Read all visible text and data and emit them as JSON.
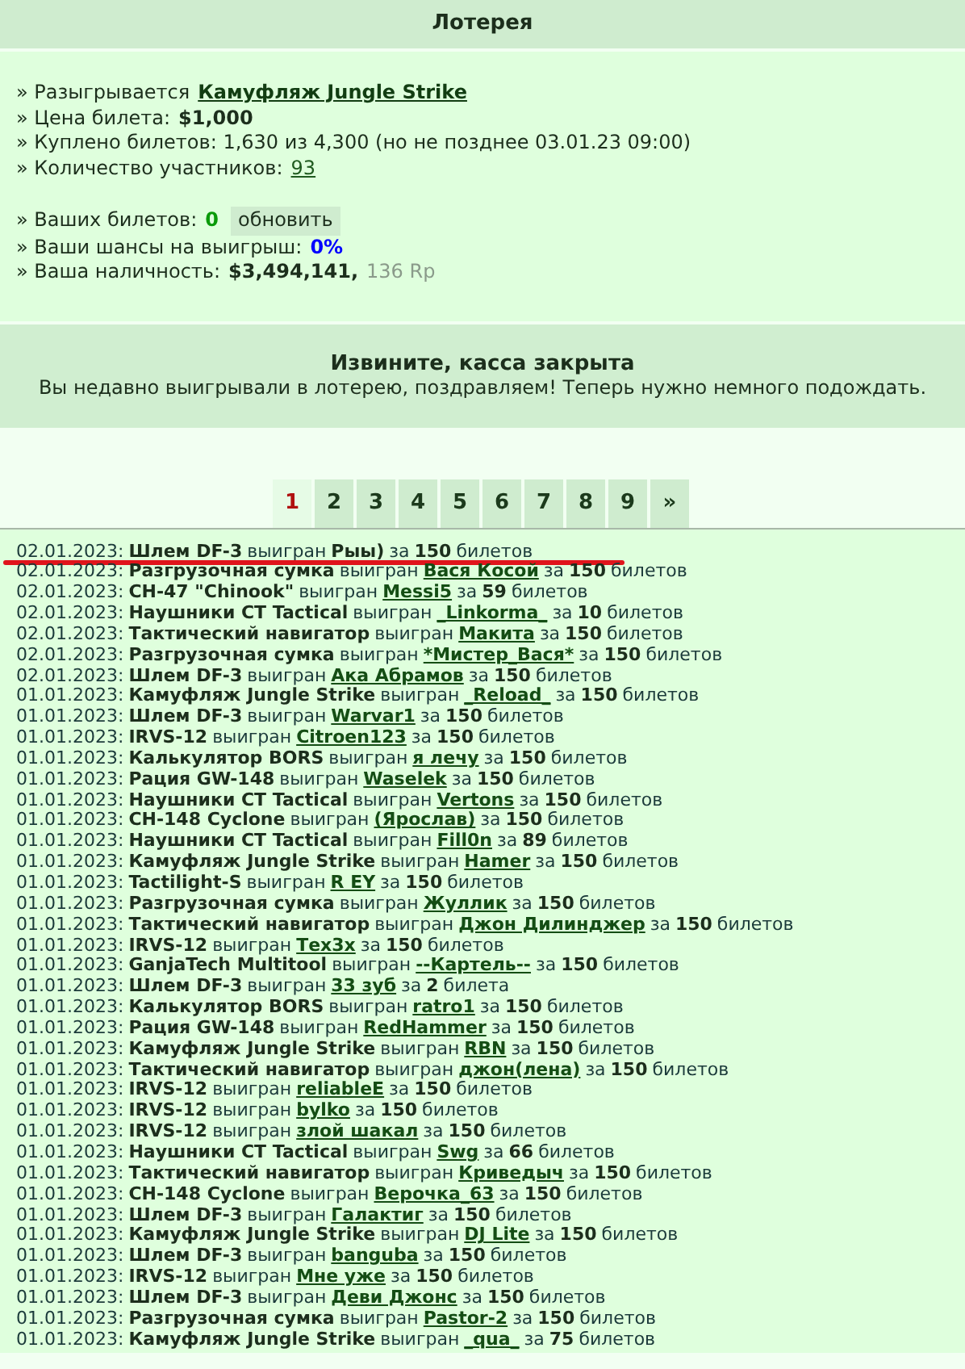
{
  "title": "Лотерея",
  "info_groups": [
    [
      {
        "label": "» Разыгрывается",
        "value": "Камуфляж Jungle Strike",
        "kind": "link"
      },
      {
        "label": "» Цена билета:",
        "value": "$1,000",
        "kind": "bold"
      },
      {
        "label": "» Куплено билетов: 1,630 из 4,300 (но не позднее 03.01.23 09:00)"
      },
      {
        "label": "» Количество участников:",
        "value": "93",
        "kind": "plainlink"
      }
    ],
    [
      {
        "label": "» Ваших билетов:",
        "value": "0",
        "kind": "green",
        "button": "обновить"
      },
      {
        "label": "» Ваши шансы на выигрыш:",
        "value": "0%",
        "kind": "blue"
      },
      {
        "label": "» Ваша наличность:",
        "value": "$3,494,141,",
        "kind": "bold",
        "extra": "136 Rp"
      }
    ]
  ],
  "closed": {
    "title": "Извините, касса закрыта",
    "text": "Вы недавно выигрывали в лотерею, поздравляем! Теперь нужно немного подождать."
  },
  "pages": [
    {
      "label": "1",
      "selected": true
    },
    {
      "label": "2",
      "selected": false
    },
    {
      "label": "3",
      "selected": false
    },
    {
      "label": "4",
      "selected": false
    },
    {
      "label": "5",
      "selected": false
    },
    {
      "label": "6",
      "selected": false
    },
    {
      "label": "7",
      "selected": false
    },
    {
      "label": "8",
      "selected": false
    },
    {
      "label": "9",
      "selected": false
    },
    {
      "label": "»",
      "selected": false
    }
  ],
  "rows": [
    {
      "date": "02.01.2023:",
      "prize": "Шлем DF-3",
      "won": "выигран",
      "winner": "Рыы)",
      "linked": false,
      "za": "за",
      "count": "150",
      "unit": "билетов",
      "marked": true
    },
    {
      "date": "02.01.2023:",
      "prize": "Разгрузочная сумка",
      "won": "выигран",
      "winner": "Вася Косой",
      "linked": true,
      "za": "за",
      "count": "150",
      "unit": "билетов",
      "marked": false
    },
    {
      "date": "02.01.2023:",
      "prize": "CH-47 \"Chinook\"",
      "won": "выигран",
      "winner": "Messi5",
      "linked": true,
      "za": "за",
      "count": "59",
      "unit": "билетов",
      "marked": false
    },
    {
      "date": "02.01.2023:",
      "prize": "Наушники CT Tactical",
      "won": "выигран",
      "winner": "_Linkorma_",
      "linked": true,
      "za": "за",
      "count": "10",
      "unit": "билетов",
      "marked": false
    },
    {
      "date": "02.01.2023:",
      "prize": "Тактический навигатор",
      "won": "выигран",
      "winner": "Макита",
      "linked": true,
      "za": "за",
      "count": "150",
      "unit": "билетов",
      "marked": false
    },
    {
      "date": "02.01.2023:",
      "prize": "Разгрузочная сумка",
      "won": "выигран",
      "winner": "*Мистер_Вася*",
      "linked": true,
      "za": "за",
      "count": "150",
      "unit": "билетов",
      "marked": false
    },
    {
      "date": "02.01.2023:",
      "prize": "Шлем DF-3",
      "won": "выигран",
      "winner": "Ака Абрамов",
      "linked": true,
      "za": "за",
      "count": "150",
      "unit": "билетов",
      "marked": false
    },
    {
      "date": "01.01.2023:",
      "prize": "Камуфляж Jungle Strike",
      "won": "выигран",
      "winner": "_Reload_",
      "linked": true,
      "za": "за",
      "count": "150",
      "unit": "билетов",
      "marked": false
    },
    {
      "date": "01.01.2023:",
      "prize": "Шлем DF-3",
      "won": "выигран",
      "winner": "Warvar1",
      "linked": true,
      "za": "за",
      "count": "150",
      "unit": "билетов",
      "marked": false
    },
    {
      "date": "01.01.2023:",
      "prize": "IRVS-12",
      "won": "выигран",
      "winner": "Citroen123",
      "linked": true,
      "za": "за",
      "count": "150",
      "unit": "билетов",
      "marked": false
    },
    {
      "date": "01.01.2023:",
      "prize": "Калькулятор BORS",
      "won": "выигран",
      "winner": "я лечу",
      "linked": true,
      "za": "за",
      "count": "150",
      "unit": "билетов",
      "marked": false
    },
    {
      "date": "01.01.2023:",
      "prize": "Рация GW-148",
      "won": "выигран",
      "winner": "Waselek",
      "linked": true,
      "za": "за",
      "count": "150",
      "unit": "билетов",
      "marked": false
    },
    {
      "date": "01.01.2023:",
      "prize": "Наушники CT Tactical",
      "won": "выигран",
      "winner": "Vertons",
      "linked": true,
      "za": "за",
      "count": "150",
      "unit": "билетов",
      "marked": false
    },
    {
      "date": "01.01.2023:",
      "prize": "CH-148 Cyclone",
      "won": "выигран",
      "winner": "(Ярослав)",
      "linked": true,
      "za": "за",
      "count": "150",
      "unit": "билетов",
      "marked": false
    },
    {
      "date": "01.01.2023:",
      "prize": "Наушники CT Tactical",
      "won": "выигран",
      "winner": "Fill0n",
      "linked": true,
      "za": "за",
      "count": "89",
      "unit": "билетов",
      "marked": false
    },
    {
      "date": "01.01.2023:",
      "prize": "Камуфляж Jungle Strike",
      "won": "выигран",
      "winner": "Hamer",
      "linked": true,
      "za": "за",
      "count": "150",
      "unit": "билетов",
      "marked": false
    },
    {
      "date": "01.01.2023:",
      "prize": "Tactilight-S",
      "won": "выигран",
      "winner": "R EY",
      "linked": true,
      "za": "за",
      "count": "150",
      "unit": "билетов",
      "marked": false
    },
    {
      "date": "01.01.2023:",
      "prize": "Разгрузочная сумка",
      "won": "выигран",
      "winner": "Жуллик",
      "linked": true,
      "za": "за",
      "count": "150",
      "unit": "билетов",
      "marked": false
    },
    {
      "date": "01.01.2023:",
      "prize": "Тактический навигатор",
      "won": "выигран",
      "winner": "Джон Дилинджер",
      "linked": true,
      "za": "за",
      "count": "150",
      "unit": "билетов",
      "marked": false
    },
    {
      "date": "01.01.2023:",
      "prize": "IRVS-12",
      "won": "выигран",
      "winner": "Тех3х",
      "linked": true,
      "za": "за",
      "count": "150",
      "unit": "билетов",
      "marked": false
    },
    {
      "date": "01.01.2023:",
      "prize": "GanjaTech Multitool",
      "won": "выигран",
      "winner": "--Картель--",
      "linked": true,
      "za": "за",
      "count": "150",
      "unit": "билетов",
      "marked": false
    },
    {
      "date": "01.01.2023:",
      "prize": "Шлем DF-3",
      "won": "выигран",
      "winner": "33 зуб",
      "linked": true,
      "za": "за",
      "count": "2",
      "unit": "билета",
      "marked": false
    },
    {
      "date": "01.01.2023:",
      "prize": "Калькулятор BORS",
      "won": "выигран",
      "winner": "ratro1",
      "linked": true,
      "za": "за",
      "count": "150",
      "unit": "билетов",
      "marked": false
    },
    {
      "date": "01.01.2023:",
      "prize": "Рация GW-148",
      "won": "выигран",
      "winner": "RedHammer",
      "linked": true,
      "za": "за",
      "count": "150",
      "unit": "билетов",
      "marked": false
    },
    {
      "date": "01.01.2023:",
      "prize": "Камуфляж Jungle Strike",
      "won": "выигран",
      "winner": "RBN",
      "linked": true,
      "za": "за",
      "count": "150",
      "unit": "билетов",
      "marked": false
    },
    {
      "date": "01.01.2023:",
      "prize": "Тактический навигатор",
      "won": "выигран",
      "winner": "джон(лена)",
      "linked": true,
      "za": "за",
      "count": "150",
      "unit": "билетов",
      "marked": false
    },
    {
      "date": "01.01.2023:",
      "prize": "IRVS-12",
      "won": "выигран",
      "winner": "reliableE",
      "linked": true,
      "za": "за",
      "count": "150",
      "unit": "билетов",
      "marked": false
    },
    {
      "date": "01.01.2023:",
      "prize": "IRVS-12",
      "won": "выигран",
      "winner": "bylko",
      "linked": true,
      "za": "за",
      "count": "150",
      "unit": "билетов",
      "marked": false
    },
    {
      "date": "01.01.2023:",
      "prize": "IRVS-12",
      "won": "выигран",
      "winner": "злой шакал",
      "linked": true,
      "za": "за",
      "count": "150",
      "unit": "билетов",
      "marked": false
    },
    {
      "date": "01.01.2023:",
      "prize": "Наушники CT Tactical",
      "won": "выигран",
      "winner": "Swg",
      "linked": true,
      "za": "за",
      "count": "66",
      "unit": "билетов",
      "marked": false
    },
    {
      "date": "01.01.2023:",
      "prize": "Тактический навигатор",
      "won": "выигран",
      "winner": "Криведыч",
      "linked": true,
      "za": "за",
      "count": "150",
      "unit": "билетов",
      "marked": false
    },
    {
      "date": "01.01.2023:",
      "prize": "CH-148 Cyclone",
      "won": "выигран",
      "winner": "Верочка_63",
      "linked": true,
      "za": "за",
      "count": "150",
      "unit": "билетов",
      "marked": false
    },
    {
      "date": "01.01.2023:",
      "prize": "Шлем DF-3",
      "won": "выигран",
      "winner": "Галактиг",
      "linked": true,
      "za": "за",
      "count": "150",
      "unit": "билетов",
      "marked": false
    },
    {
      "date": "01.01.2023:",
      "prize": "Камуфляж Jungle Strike",
      "won": "выигран",
      "winner": "DJ Lite",
      "linked": true,
      "za": "за",
      "count": "150",
      "unit": "билетов",
      "marked": false
    },
    {
      "date": "01.01.2023:",
      "prize": "Шлем DF-3",
      "won": "выигран",
      "winner": "banguba",
      "linked": true,
      "za": "за",
      "count": "150",
      "unit": "билетов",
      "marked": false
    },
    {
      "date": "01.01.2023:",
      "prize": "IRVS-12",
      "won": "выигран",
      "winner": "Мне уже",
      "linked": true,
      "za": "за",
      "count": "150",
      "unit": "билетов",
      "marked": false
    },
    {
      "date": "01.01.2023:",
      "prize": "Шлем DF-3",
      "won": "выигран",
      "winner": "Деви Джонс",
      "linked": true,
      "za": "за",
      "count": "150",
      "unit": "билетов",
      "marked": false
    },
    {
      "date": "01.01.2023:",
      "prize": "Разгрузочная сумка",
      "won": "выигран",
      "winner": "Pastor-2",
      "linked": true,
      "za": "за",
      "count": "150",
      "unit": "билетов",
      "marked": false
    },
    {
      "date": "01.01.2023:",
      "prize": "Камуфляж Jungle Strike",
      "won": "выигран",
      "winner": "_qua_",
      "linked": true,
      "za": "за",
      "count": "75",
      "unit": "билетов",
      "marked": false
    }
  ]
}
